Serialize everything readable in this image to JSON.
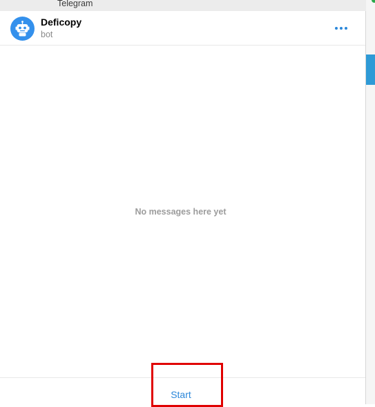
{
  "app": {
    "window_title": "Telegram"
  },
  "chat": {
    "name": "Deficopy",
    "status": "bot",
    "avatar_icon": "robot-icon",
    "avatar_color": "#3390ec",
    "menu_icon": "more-dots-icon"
  },
  "messages": {
    "empty_text": "No messages here yet"
  },
  "bottom_bar": {
    "start_label": "Start"
  },
  "colors": {
    "accent": "#3390ec",
    "link": "#2b87d9",
    "highlight": "#e00000",
    "side_accent": "#2e9ad6"
  }
}
